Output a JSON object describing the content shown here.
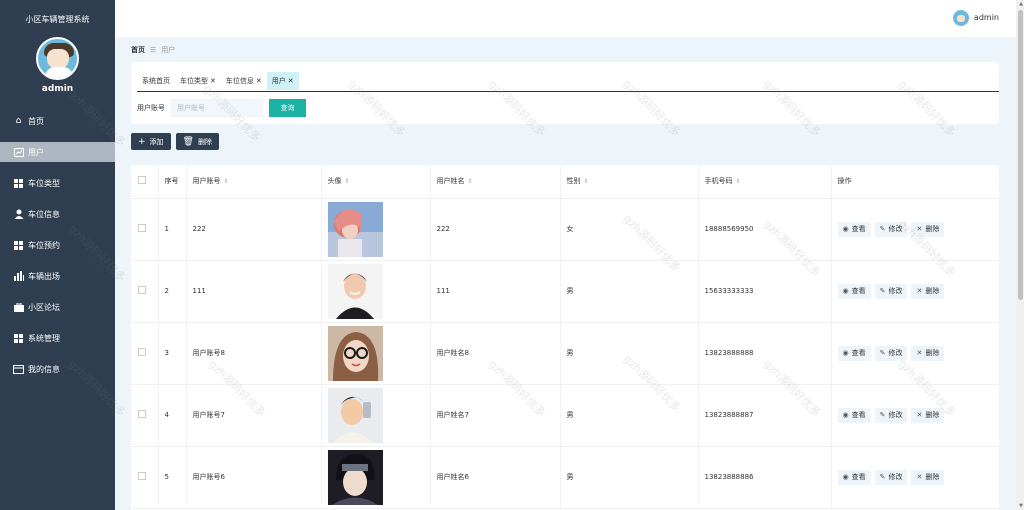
{
  "sidebar": {
    "title": "小区车辆管理系统",
    "username": "admin",
    "items": [
      {
        "label": "首页",
        "icon": "home-icon"
      },
      {
        "label": "用户",
        "icon": "chart-icon"
      },
      {
        "label": "车位类型",
        "icon": "grid-icon"
      },
      {
        "label": "车位信息",
        "icon": "user-icon"
      },
      {
        "label": "车位预约",
        "icon": "grid-icon"
      },
      {
        "label": "车辆出场",
        "icon": "bar-chart-icon"
      },
      {
        "label": "小区论坛",
        "icon": "briefcase-icon"
      },
      {
        "label": "系统管理",
        "icon": "grid-icon"
      },
      {
        "label": "我的信息",
        "icon": "card-icon"
      }
    ]
  },
  "header": {
    "username": "admin"
  },
  "breadcrumb": {
    "home": "首页",
    "current": "用户"
  },
  "tabs": [
    {
      "label": "系统首页",
      "closable": false
    },
    {
      "label": "车位类型",
      "closable": true
    },
    {
      "label": "车位信息",
      "closable": true
    },
    {
      "label": "用户",
      "closable": true
    }
  ],
  "search": {
    "label": "用户账号",
    "placeholder": "用户账号",
    "button": "查询"
  },
  "toolbar": {
    "add": "添加",
    "delete": "删除"
  },
  "table": {
    "headers": [
      "序号",
      "用户账号",
      "头像",
      "用户姓名",
      "性别",
      "手机号码",
      "操作"
    ],
    "ops": {
      "view": "查看",
      "edit": "修改",
      "delete": "删除"
    },
    "rows": [
      {
        "no": "1",
        "account": "222",
        "name": "222",
        "gender": "女",
        "phone": "18888569950"
      },
      {
        "no": "2",
        "account": "111",
        "name": "111",
        "gender": "男",
        "phone": "15633333333"
      },
      {
        "no": "3",
        "account": "用户账号8",
        "name": "用户姓名8",
        "gender": "男",
        "phone": "13823888888"
      },
      {
        "no": "4",
        "account": "用户账号7",
        "name": "用户姓名7",
        "gender": "男",
        "phone": "13823888887"
      },
      {
        "no": "5",
        "account": "用户账号6",
        "name": "用户姓名6",
        "gender": "男",
        "phone": "13823888886"
      }
    ]
  },
  "watermark": "gzh源码好优多",
  "colors": {
    "sidebar": "#2f3f51",
    "accent": "#19b2a4",
    "background": "#eef5fa"
  }
}
